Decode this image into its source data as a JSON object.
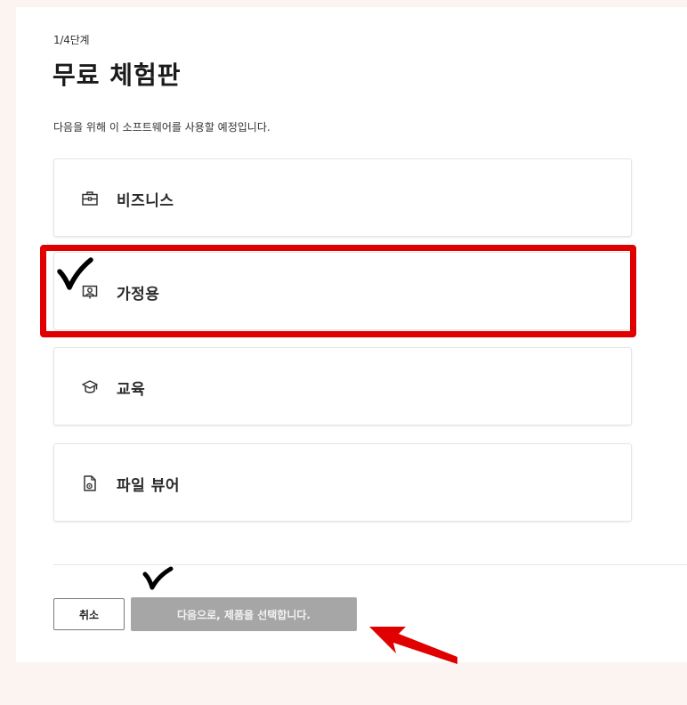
{
  "header": {
    "step": "1/4단계",
    "title": "무료 체험판",
    "subtitle": "다음을 위해 이 소프트웨어를 사용할 예정입니다."
  },
  "options": [
    {
      "label": "비즈니스",
      "icon": "briefcase-icon"
    },
    {
      "label": "가정용",
      "icon": "home-person-icon",
      "selected": true
    },
    {
      "label": "교육",
      "icon": "graduation-cap-icon"
    },
    {
      "label": "파일 뷰어",
      "icon": "file-viewer-icon"
    }
  ],
  "footer": {
    "cancel_label": "취소",
    "next_label": "다음으로, 제품을 선택합니다."
  },
  "annotations": {
    "highlight_color": "#e00000",
    "check_color": "#000000",
    "arrow_color": "#e00000"
  }
}
